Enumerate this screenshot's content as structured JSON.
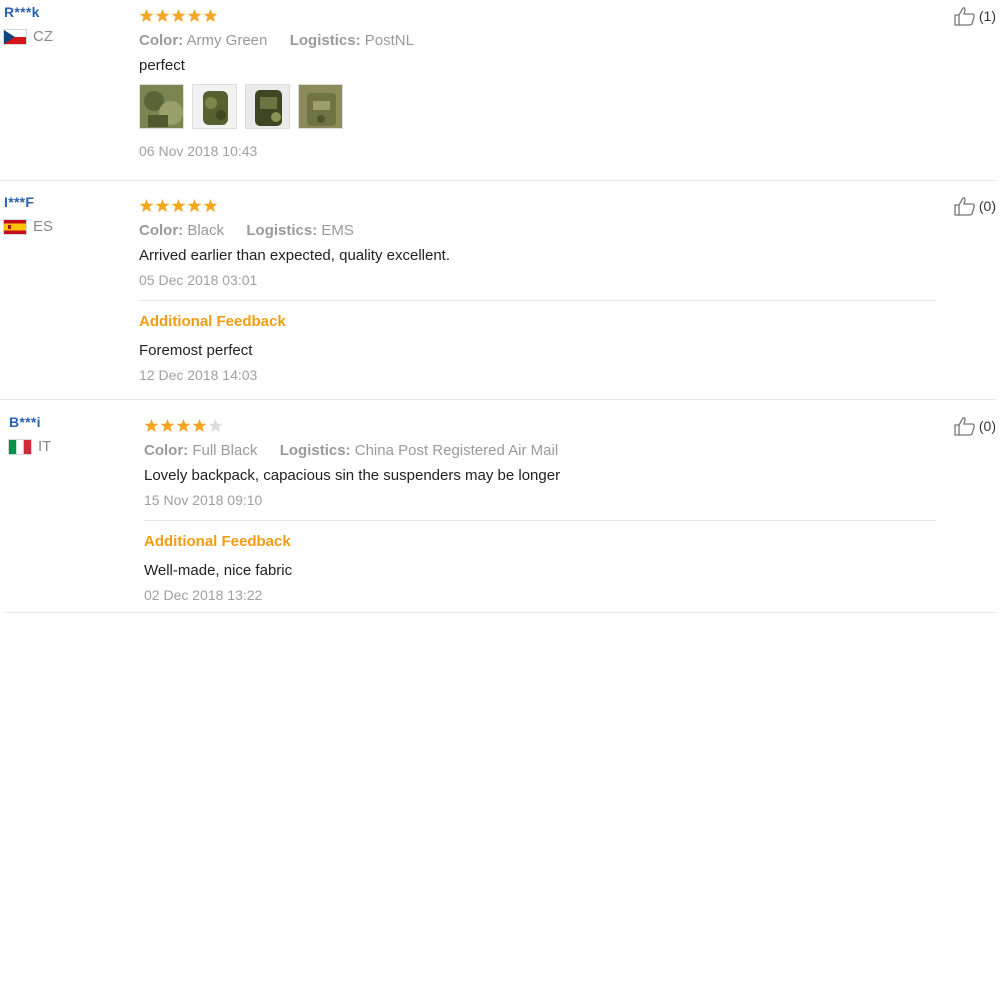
{
  "reviews": [
    {
      "user": "R***k",
      "country": "CZ",
      "flag": "flag-czech",
      "rating": 5,
      "color_label": "Color:",
      "color_value": "Army Green",
      "logistics_label": "Logistics:",
      "logistics_value": "PostNL",
      "text": "perfect",
      "photos": [
        "backpack-photo",
        "backpack-photo",
        "backpack-photo",
        "backpack-photo"
      ],
      "date": "06 Nov 2018 10:43",
      "likes": "(1)"
    },
    {
      "user": "I***F",
      "country": "ES",
      "flag": "flag-spain",
      "rating": 5,
      "color_label": "Color:",
      "color_value": "Black",
      "logistics_label": "Logistics:",
      "logistics_value": "EMS",
      "text": "Arrived earlier than expected, quality excellent.",
      "date": "05 Dec 2018 03:01",
      "additional": {
        "title": "Additional Feedback",
        "text": "Foremost perfect",
        "date": "12 Dec 2018 14:03"
      },
      "likes": "(0)"
    },
    {
      "user": "B***i",
      "country": "IT",
      "flag": "flag-italy",
      "rating": 4,
      "color_label": "Color:",
      "color_value": "Full Black",
      "logistics_label": "Logistics:",
      "logistics_value": "China Post Registered Air Mail",
      "text": "Lovely backpack, capacious sin the suspenders may be longer",
      "date": "15 Nov 2018 09:10",
      "additional": {
        "title": "Additional Feedback",
        "text": "Well-made, nice fabric",
        "date": "02 Dec 2018 13:22"
      },
      "likes": "(0)"
    }
  ],
  "colors": {
    "star_filled": "#f5a623",
    "star_empty": "#dddddd",
    "username": "#2a62b0",
    "additional_title": "#f39c12"
  },
  "icons": {
    "star": "star-icon",
    "thumbs_up": "thumbs-up-icon"
  }
}
